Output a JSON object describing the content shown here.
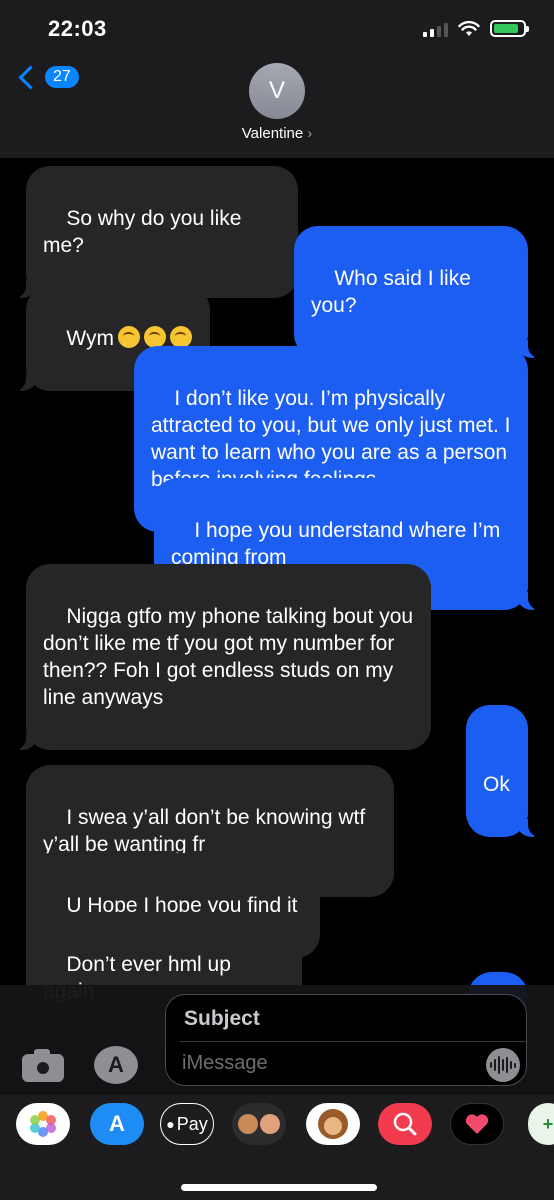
{
  "status_bar": {
    "time": "22:03"
  },
  "nav": {
    "back_count": "27",
    "avatar_initial": "V",
    "contact_name": "Valentine",
    "contact_arrow": "›"
  },
  "messages": [
    {
      "dir": "in",
      "text": "So why do you like me?"
    },
    {
      "dir": "out",
      "text": "Who said I like you?"
    },
    {
      "dir": "in",
      "text": "Wym"
    },
    {
      "dir": "out",
      "text": "I don’t like you. I’m physically attracted to you, but we only just met. I want to learn who you are as a person before involving feelings."
    },
    {
      "dir": "out",
      "text": "I hope you understand where I’m coming from"
    },
    {
      "dir": "in",
      "text": "Nigga gtfo my phone talking bout you don’t like me tf you got my number for then?? Foh I got endless studs on my line anyways"
    },
    {
      "dir": "out",
      "text": "Ok"
    },
    {
      "dir": "in",
      "text": "I swea y’all don’t be knowing wtf y’all be wanting fr"
    },
    {
      "dir": "in",
      "text": "U Hope I hope you find it"
    },
    {
      "dir": "in",
      "text": "Don’t ever hml up again"
    }
  ],
  "compose": {
    "subject_label": "Subject",
    "message_placeholder": "iMessage"
  },
  "app_strip": [
    {
      "name": "photos-app",
      "label": ""
    },
    {
      "name": "app-store-app",
      "label": ""
    },
    {
      "name": "apple-pay-app",
      "label": "Pay"
    },
    {
      "name": "memoji-app",
      "label": ""
    },
    {
      "name": "animoji-app",
      "label": ""
    },
    {
      "name": "web-search-app",
      "label": ""
    },
    {
      "name": "digital-touch-app",
      "label": ""
    },
    {
      "name": "more-app",
      "label": ""
    }
  ],
  "colors": {
    "outgoing_bubble": "#1c5ef2",
    "incoming_bubble": "#262628",
    "accent": "#0a84ff",
    "battery_fill": "#34c759"
  }
}
